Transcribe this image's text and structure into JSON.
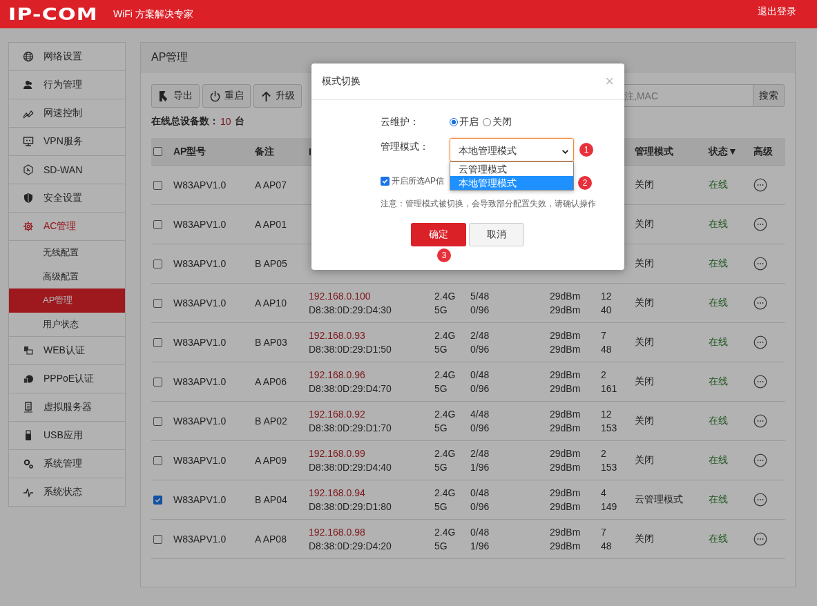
{
  "header": {
    "logo": "IP-COM",
    "tagline": "WiFi 方案解决专家",
    "logout": "退出登录"
  },
  "sidebar": {
    "items": [
      {
        "label": "网络设置",
        "kind": "globe",
        "selected": false
      },
      {
        "label": "行为管理",
        "kind": "users",
        "selected": false
      },
      {
        "label": "网速控制",
        "kind": "speed",
        "selected": false
      },
      {
        "label": "VPN服务",
        "kind": "monitor",
        "selected": false
      },
      {
        "label": "SD-WAN",
        "kind": "hex",
        "selected": false
      },
      {
        "label": "安全设置",
        "kind": "shield",
        "selected": false
      },
      {
        "label": "AC管理",
        "kind": "ac",
        "selected": true,
        "children": [
          {
            "label": "无线配置",
            "selected": false
          },
          {
            "label": "高级配置",
            "selected": false
          },
          {
            "label": "AP管理",
            "selected": true
          },
          {
            "label": "用户状态",
            "selected": false
          }
        ]
      },
      {
        "label": "WEB认证",
        "kind": "web",
        "selected": false
      },
      {
        "label": "PPPoE认证",
        "kind": "pppoe",
        "selected": false
      },
      {
        "label": "虚拟服务器",
        "kind": "server",
        "selected": false
      },
      {
        "label": "USB应用",
        "kind": "usb",
        "selected": false
      },
      {
        "label": "系统管理",
        "kind": "gears",
        "selected": false
      },
      {
        "label": "系统状态",
        "kind": "pulse",
        "selected": false
      }
    ]
  },
  "panel": {
    "title": "AP管理",
    "toolbar": [
      {
        "label": "导出",
        "kind": "export"
      },
      {
        "label": "重启",
        "kind": "power"
      },
      {
        "label": "升级",
        "kind": "upload"
      }
    ],
    "search": {
      "placeholder": "注,MAC",
      "button": "搜索"
    },
    "summary": {
      "label": "在线总设备数：",
      "value": "10",
      "unit": "台"
    },
    "table": {
      "header": {
        "select_all": false,
        "model": "AP型号",
        "note": "备注",
        "column_3": "I",
        "mode": "管理模式",
        "status": "状态▼",
        "advanced": "高级"
      },
      "rows": [
        {
          "checked": false,
          "model": "W83APV1.0",
          "note": "A AP07",
          "mode": "关闭",
          "status": "在线"
        },
        {
          "checked": false,
          "model": "W83APV1.0",
          "note": "A AP01",
          "mode": "关闭",
          "status": "在线"
        },
        {
          "checked": false,
          "model": "W83APV1.0",
          "note": "B AP05",
          "mode": "关闭",
          "status": "在线"
        },
        {
          "checked": false,
          "model": "W83APV1.0",
          "note": "A AP10",
          "ip": "192.168.0.100",
          "mac": "D8:38:0D:29:D4:30",
          "line_1": {
            "band": "2.4G",
            "clients": "5/48",
            "power": "29dBm",
            "count": "12"
          },
          "line_2": {
            "band": "5G",
            "clients": "0/96",
            "power": "29dBm",
            "count": "40"
          },
          "mode": "关闭",
          "status": "在线"
        },
        {
          "checked": false,
          "model": "W83APV1.0",
          "note": "B AP03",
          "ip": "192.168.0.93",
          "mac": "D8:38:0D:29:D1:50",
          "line_1": {
            "band": "2.4G",
            "clients": "2/48",
            "power": "29dBm",
            "count": "7"
          },
          "line_2": {
            "band": "5G",
            "clients": "0/96",
            "power": "29dBm",
            "count": "48"
          },
          "mode": "关闭",
          "status": "在线"
        },
        {
          "checked": false,
          "model": "W83APV1.0",
          "note": "A AP06",
          "ip": "192.168.0.96",
          "mac": "D8:38:0D:29:D4:70",
          "line_1": {
            "band": "2.4G",
            "clients": "0/48",
            "power": "29dBm",
            "count": "2"
          },
          "line_2": {
            "band": "5G",
            "clients": "0/96",
            "power": "29dBm",
            "count": "161"
          },
          "mode": "关闭",
          "status": "在线"
        },
        {
          "checked": false,
          "model": "W83APV1.0",
          "note": "B AP02",
          "ip": "192.168.0.92",
          "mac": "D8:38:0D:29:D1:70",
          "line_1": {
            "band": "2.4G",
            "clients": "4/48",
            "power": "29dBm",
            "count": "12"
          },
          "line_2": {
            "band": "5G",
            "clients": "0/96",
            "power": "29dBm",
            "count": "153"
          },
          "mode": "关闭",
          "status": "在线"
        },
        {
          "checked": false,
          "model": "W83APV1.0",
          "note": "A AP09",
          "ip": "192.168.0.99",
          "mac": "D8:38:0D:29:D4:40",
          "line_1": {
            "band": "2.4G",
            "clients": "2/48",
            "power": "29dBm",
            "count": "2"
          },
          "line_2": {
            "band": "5G",
            "clients": "1/96",
            "power": "29dBm",
            "count": "153"
          },
          "mode": "关闭",
          "status": "在线"
        },
        {
          "checked": true,
          "model": "W83APV1.0",
          "note": "B AP04",
          "ip": "192.168.0.94",
          "mac": "D8:38:0D:29:D1:80",
          "line_1": {
            "band": "2.4G",
            "clients": "0/48",
            "power": "29dBm",
            "count": "4"
          },
          "line_2": {
            "band": "5G",
            "clients": "0/96",
            "power": "29dBm",
            "count": "149"
          },
          "mode": "云管理模式",
          "status": "在线"
        },
        {
          "checked": false,
          "model": "W83APV1.0",
          "note": "A AP08",
          "ip": "192.168.0.98",
          "mac": "D8:38:0D:29:D4:20",
          "line_1": {
            "band": "2.4G",
            "clients": "0/48",
            "power": "29dBm",
            "count": "7"
          },
          "line_2": {
            "band": "5G",
            "clients": "1/96",
            "power": "29dBm",
            "count": "48"
          },
          "mode": "关闭",
          "status": "在线"
        }
      ]
    }
  },
  "modal": {
    "title": "模式切换",
    "close": "×",
    "cloud": {
      "label": "云维护：",
      "options": [
        {
          "label": "开启",
          "selected": true
        },
        {
          "label": "关闭",
          "selected": false
        }
      ]
    },
    "mode": {
      "label": "管理模式：",
      "value": "本地管理模式",
      "open": true,
      "options": [
        {
          "label": "云管理模式",
          "selected": false
        },
        {
          "label": "本地管理模式",
          "selected": true
        }
      ]
    },
    "sync": {
      "label": "开启所选AP信",
      "checked": true
    },
    "note": "注意：管理模式被切换，会导致部分配置失效，请确认操作",
    "confirm": "确定",
    "cancel": "取消",
    "markers": [
      "1",
      "2",
      "3"
    ]
  }
}
